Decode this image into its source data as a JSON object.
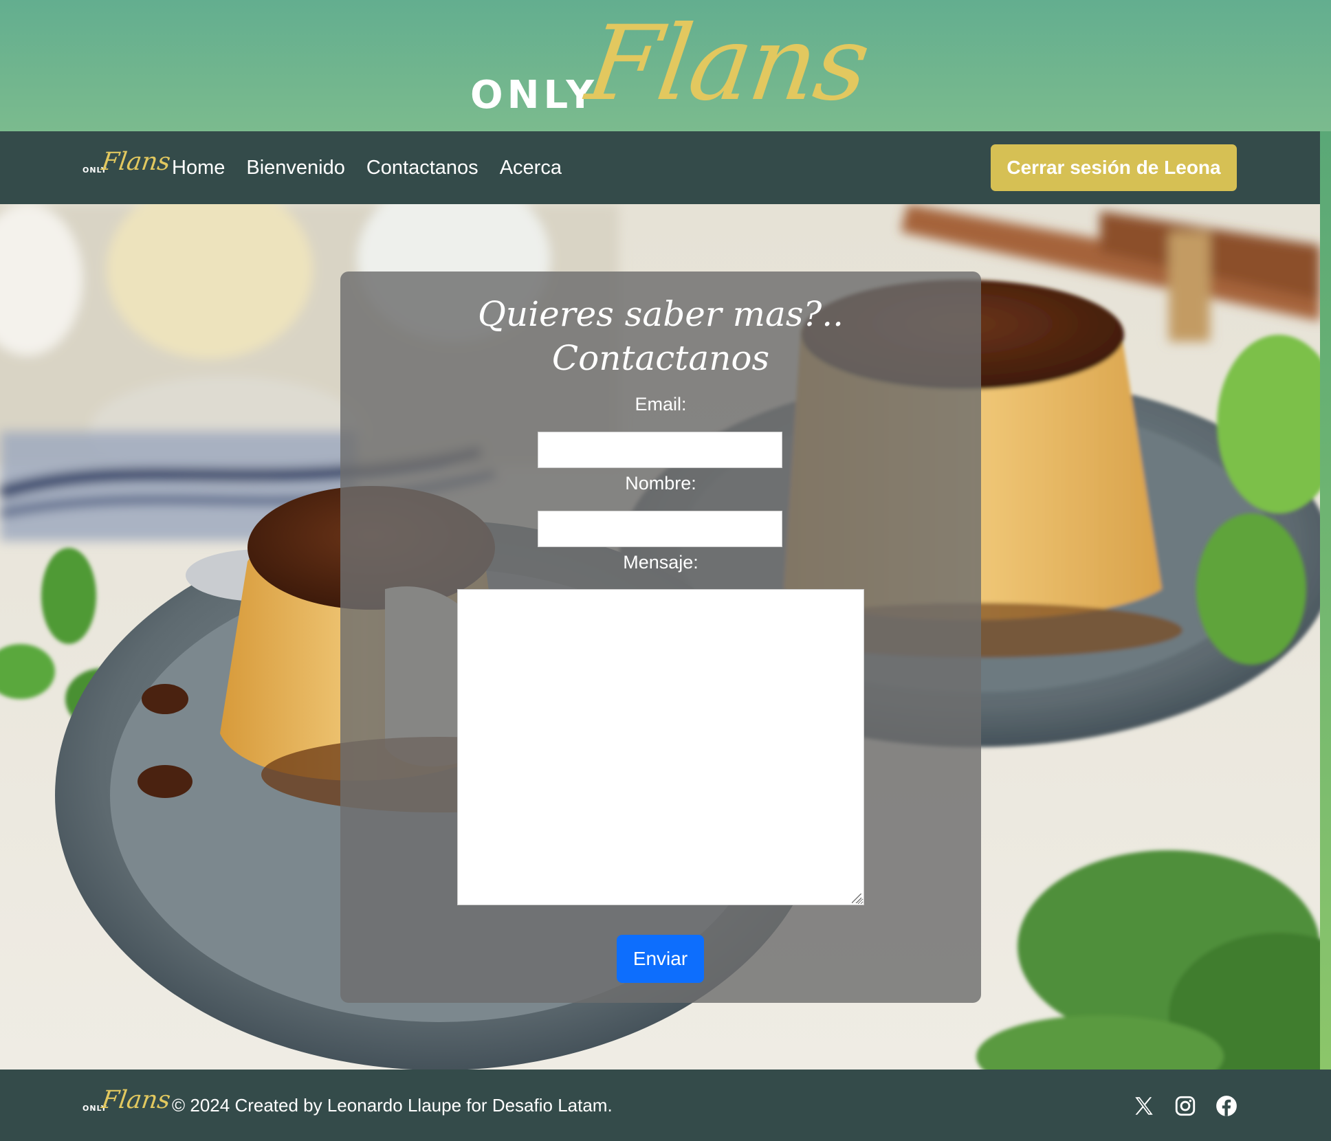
{
  "brand": {
    "only": "ONLY",
    "flans": "Flans"
  },
  "nav": {
    "links": [
      "Home",
      "Bienvenido",
      "Contactanos",
      "Acerca"
    ],
    "logout_label": "Cerrar sesión de Leona"
  },
  "contact": {
    "title_line1": "Quieres saber mas?..",
    "title_line2": "Contactanos",
    "email_label": "Email:",
    "email_value": "",
    "name_label": "Nombre:",
    "name_value": "",
    "message_label": "Mensaje:",
    "message_value": "",
    "submit_label": "Enviar"
  },
  "footer": {
    "text": "© 2024 Created by Leonardo Llaupe for Desafio Latam.",
    "social_icons": [
      "x-icon",
      "instagram-icon",
      "facebook-icon"
    ]
  },
  "colors": {
    "banner_green": "#63ae8f",
    "nav_dark": "#344b4a",
    "gold": "#e2c85f",
    "button_gold": "#d6c054",
    "primary_blue": "#0d6efd"
  }
}
